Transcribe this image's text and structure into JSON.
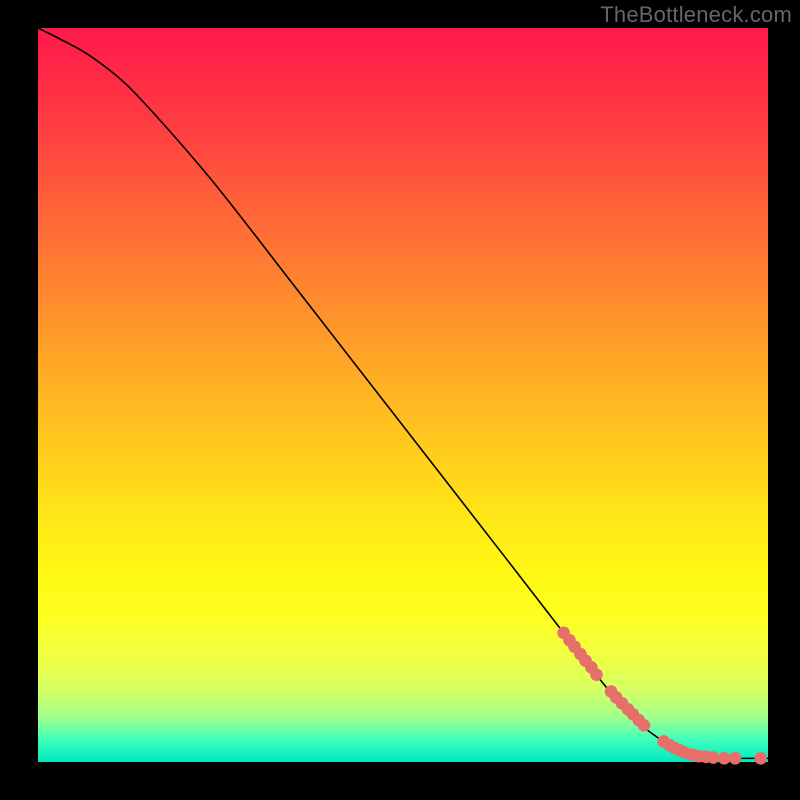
{
  "watermark": "TheBottleneck.com",
  "chart_data": {
    "type": "line",
    "title": "",
    "xlabel": "",
    "ylabel": "",
    "xlim": [
      0,
      100
    ],
    "ylim": [
      0,
      100
    ],
    "grid": false,
    "legend": false,
    "series": [
      {
        "name": "curve",
        "x": [
          0,
          3,
          7,
          12,
          18,
          25,
          35,
          45,
          55,
          65,
          72,
          78,
          82,
          86,
          89,
          92,
          95,
          100
        ],
        "y": [
          100,
          98.5,
          96.3,
          92.4,
          86.0,
          77.8,
          65.0,
          52.2,
          39.4,
          26.6,
          17.6,
          10.0,
          5.6,
          2.6,
          1.2,
          0.6,
          0.5,
          0.5
        ]
      }
    ],
    "markers": {
      "name": "highlighted-points",
      "color": "#e76f6a",
      "points": [
        {
          "x": 72.0,
          "y": 17.6
        },
        {
          "x": 72.8,
          "y": 16.6
        },
        {
          "x": 73.5,
          "y": 15.7
        },
        {
          "x": 74.3,
          "y": 14.7
        },
        {
          "x": 75.0,
          "y": 13.8
        },
        {
          "x": 75.8,
          "y": 12.9
        },
        {
          "x": 76.5,
          "y": 11.9
        },
        {
          "x": 78.5,
          "y": 9.6
        },
        {
          "x": 79.2,
          "y": 8.8
        },
        {
          "x": 80.0,
          "y": 8.0
        },
        {
          "x": 80.8,
          "y": 7.2
        },
        {
          "x": 81.5,
          "y": 6.5
        },
        {
          "x": 82.3,
          "y": 5.7
        },
        {
          "x": 83.0,
          "y": 5.0
        },
        {
          "x": 85.7,
          "y": 2.8
        },
        {
          "x": 86.5,
          "y": 2.3
        },
        {
          "x": 87.2,
          "y": 1.9
        },
        {
          "x": 87.9,
          "y": 1.6
        },
        {
          "x": 88.6,
          "y": 1.3
        },
        {
          "x": 89.6,
          "y": 1.0
        },
        {
          "x": 90.5,
          "y": 0.8
        },
        {
          "x": 91.5,
          "y": 0.7
        },
        {
          "x": 92.5,
          "y": 0.6
        },
        {
          "x": 94.0,
          "y": 0.5
        },
        {
          "x": 95.5,
          "y": 0.5
        },
        {
          "x": 99.0,
          "y": 0.5
        }
      ]
    }
  }
}
